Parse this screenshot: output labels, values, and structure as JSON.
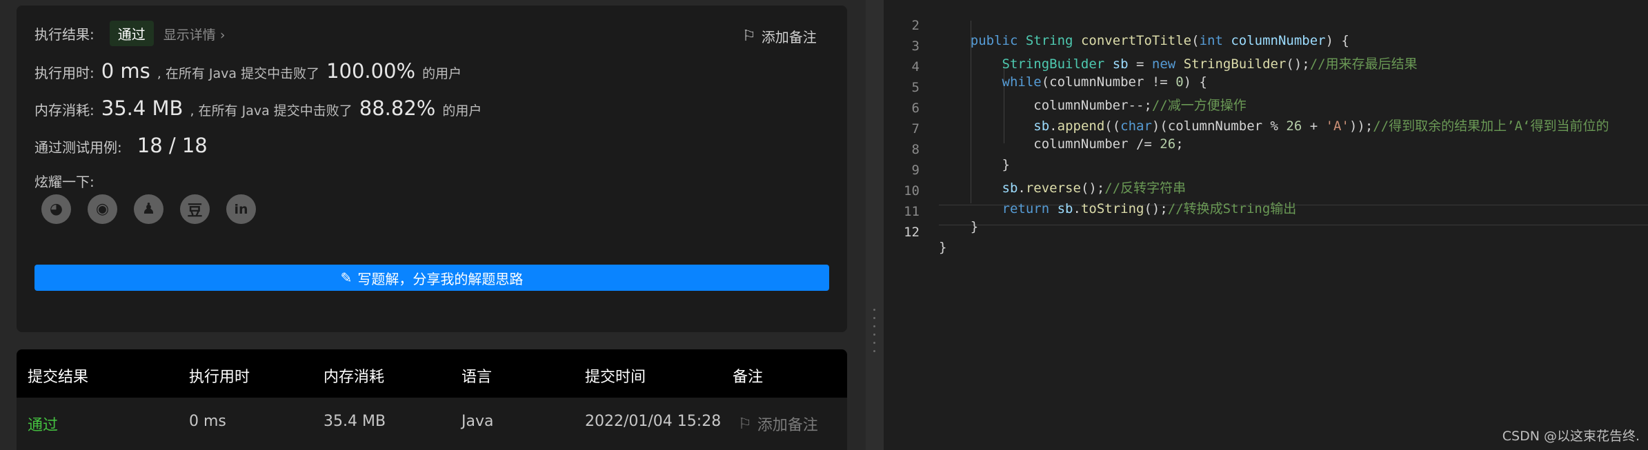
{
  "result": {
    "status_label": "执行结果:",
    "status_value": "通过",
    "details_link": "显示详情",
    "details_chevron": "›",
    "add_note": "添加备注",
    "runtime_label": "执行用时:",
    "runtime_value": "0 ms",
    "runtime_text": ", 在所有 Java 提交中击败了",
    "runtime_percent": "100.00%",
    "runtime_suffix": "的用户",
    "memory_label": "内存消耗:",
    "memory_value": "35.4 MB",
    "memory_text": ", 在所有 Java 提交中击败了",
    "memory_percent": "88.82%",
    "memory_suffix": "的用户",
    "tests_label": "通过测试用例:",
    "tests_value": "18 / 18",
    "share_label": "炫耀一下:",
    "share_icons": [
      "wechat-icon",
      "weibo-icon",
      "qq-icon",
      "douban-icon",
      "linkedin-icon"
    ],
    "share_glyphs": [
      "◕",
      "◉",
      "♟",
      "豆",
      "in"
    ],
    "write_button": "写题解，分享我的解题思路"
  },
  "submissions": {
    "headers": [
      "提交结果",
      "执行用时",
      "内存消耗",
      "语言",
      "提交时间",
      "备注"
    ],
    "rows": [
      {
        "result": "通过",
        "runtime": "0 ms",
        "memory": "35.4 MB",
        "language": "Java",
        "time": "2022/01/04 15:28",
        "note": "添加备注"
      }
    ]
  },
  "editor": {
    "line_numbers": [
      "2",
      "3",
      "4",
      "5",
      "6",
      "7",
      "8",
      "9",
      "10",
      "11",
      "12"
    ]
  },
  "watermark": "CSDN @以这束花告终.",
  "colors": {
    "accent": "#0a84ff",
    "pass": "#44c040"
  }
}
